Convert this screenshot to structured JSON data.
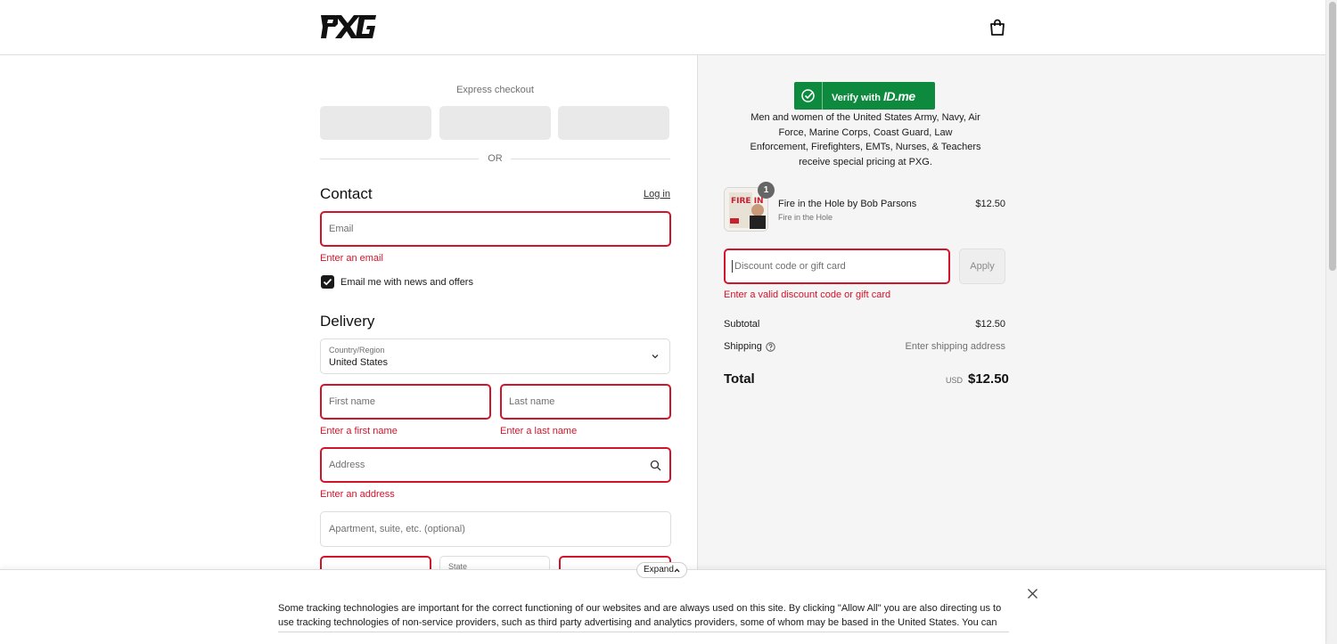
{
  "header": {
    "logo_text": "PXG",
    "logo_icon": "pxg-logo",
    "cart_icon": "shopping-bag-icon"
  },
  "express": {
    "label": "Express checkout",
    "or_text": "OR"
  },
  "contact": {
    "title": "Contact",
    "login_label": "Log in",
    "email_placeholder": "Email",
    "email_error": "Enter an email",
    "news_label": "Email me with news and offers",
    "news_checked": true
  },
  "delivery": {
    "title": "Delivery",
    "country_label": "Country/Region",
    "country_value": "United States",
    "first_name_placeholder": "First name",
    "first_name_error": "Enter a first name",
    "last_name_placeholder": "Last name",
    "last_name_error": "Enter a last name",
    "address_placeholder": "Address",
    "address_error": "Enter an address",
    "apartment_placeholder": "Apartment, suite, etc. (optional)",
    "state_label": "State"
  },
  "idme": {
    "button_prefix": "Verify with",
    "brand": "ID.me",
    "description": "Men and women of the United States Army, Navy, Air Force, Marine Corps, Coast Guard, Law Enforcement, Firefighters, EMTs, Nurses, & Teachers receive special pricing at PXG."
  },
  "cart": {
    "items": [
      {
        "name": "Fire in the Hole by Bob Parsons",
        "variant": "Fire in the Hole",
        "price": "$12.50",
        "quantity": "1",
        "image_text": "FIRE IN THE HOLE"
      }
    ],
    "discount_placeholder": "Discount code or gift card",
    "discount_error": "Enter a valid discount code or gift card",
    "apply_label": "Apply"
  },
  "summary": {
    "subtotal_label": "Subtotal",
    "subtotal_value": "$12.50",
    "shipping_label": "Shipping",
    "shipping_value": "Enter shipping address",
    "total_label": "Total",
    "total_currency": "USD",
    "total_value": "$12.50"
  },
  "cookie_banner": {
    "expand_label": "Expand",
    "text": "Some tracking technologies are important for the correct functioning of our websites and are always used on this site. By clicking \"Allow All\" you are also directing us to use tracking technologies of non-service providers, such as third party advertising and analytics providers, some of whom may be based in the United States. You can"
  },
  "colors": {
    "error": "#d1142b",
    "idme_green": "#0e8a3f",
    "panel_bg": "#f5f5f5"
  }
}
